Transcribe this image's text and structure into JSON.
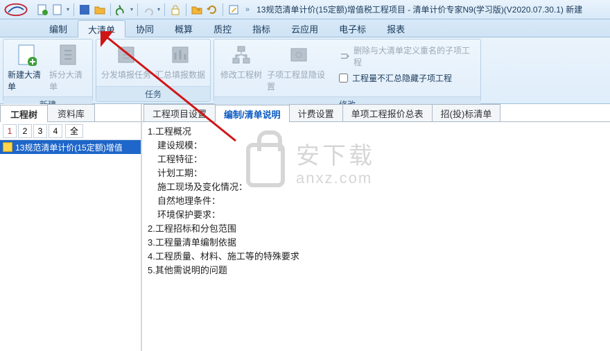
{
  "title": "13规范清单计价(15定额)增值税工程项目 - 清单计价专家N9(学习版)(V2020.07.30.1) 新建",
  "ribbon_tabs": [
    "编制",
    "大清单",
    "协同",
    "概算",
    "质控",
    "指标",
    "云应用",
    "电子标",
    "报表"
  ],
  "ribbon_active_tab": 1,
  "ribbon_groups": {
    "g1": {
      "label": "新建",
      "btns": [
        "新建大清单",
        "拆分大清单"
      ]
    },
    "g2": {
      "label": "任务",
      "btns": [
        "分发填报任务",
        "汇总填报数据"
      ]
    },
    "g3": {
      "label": "修改",
      "btns": [
        "修改工程树",
        "子项工程显隐设置"
      ],
      "link": "删除与大清单定义重名的子项工程",
      "chk": "工程量不汇总隐藏子项工程"
    }
  },
  "left_tabs": [
    "工程树",
    "资料库"
  ],
  "left_active_tab": 0,
  "pages": [
    "1",
    "2",
    "3",
    "4"
  ],
  "page_all": "全",
  "tree_item": "13规范清单计价(15定额)增值",
  "right_tabs": [
    "工程项目设置",
    "编制/清单说明",
    "计费设置",
    "单项工程报价总表",
    "招(投)标清单"
  ],
  "right_active_tab": 1,
  "doc": {
    "s1": "1.工程概况",
    "s1_1": "建设规模：",
    "s1_2": "工程特征：",
    "s1_3": "计划工期：",
    "s1_4": "施工现场及变化情况：",
    "s1_5": "自然地理条件：",
    "s1_6": "环境保护要求：",
    "s2": "2.工程招标和分包范围",
    "s3": "3.工程量清单编制依据",
    "s4": "4.工程质量、材料、施工等的特殊要求",
    "s5": "5.其他需说明的问题"
  },
  "watermark": {
    "cn": "安下载",
    "en": "anxz.com"
  }
}
